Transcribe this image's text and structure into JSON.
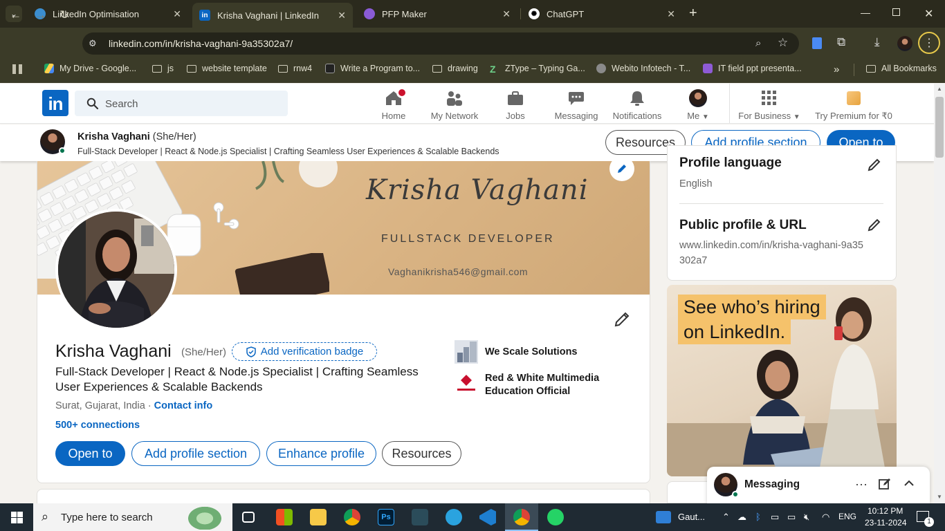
{
  "browser": {
    "tabs": [
      {
        "title": "LinkedIn Optimisation",
        "active": false
      },
      {
        "title": "Krisha Vaghani | LinkedIn",
        "active": true
      },
      {
        "title": "PFP Maker",
        "active": false
      },
      {
        "title": "ChatGPT",
        "active": false
      }
    ],
    "url": "linkedin.com/in/krisha-vaghani-9a35302a7/",
    "bookmarks": [
      "My Drive - Google...",
      "js",
      "website template",
      "rnw4",
      "Write a Program to...",
      "drawing",
      "ZType – Typing Ga...",
      "Webito Infotech - T...",
      "IT field ppt presenta..."
    ],
    "all_bookmarks": "All Bookmarks"
  },
  "linkedin": {
    "search_placeholder": "Search",
    "nav": [
      {
        "label": "Home",
        "icon": "home-icon"
      },
      {
        "label": "My Network",
        "icon": "network-icon"
      },
      {
        "label": "Jobs",
        "icon": "briefcase-icon"
      },
      {
        "label": "Messaging",
        "icon": "message-icon"
      },
      {
        "label": "Notifications",
        "icon": "bell-icon"
      },
      {
        "label": "Me",
        "icon": "avatar"
      },
      {
        "label": "For Business",
        "icon": "grid-icon"
      },
      {
        "label": "Try Premium for ₹0",
        "icon": "premium-icon"
      }
    ],
    "colors": {
      "brand": "#0a66c2",
      "online": "#01754f"
    }
  },
  "sticky": {
    "name": "Krisha Vaghani",
    "pronoun": "(She/Her)",
    "headline": "Full-Stack Developer | React & Node.js Specialist | Crafting Seamless User Experiences & Scalable Backends",
    "buttons": {
      "resources": "Resources",
      "add_section": "Add profile section",
      "open_to": "Open to"
    }
  },
  "banner": {
    "name": "Krisha Vaghani",
    "role": "FULLSTACK DEVELOPER",
    "email": "Vaghanikrisha546@gmail.com"
  },
  "profile": {
    "name": "Krisha Vaghani",
    "pronoun": "(She/Her)",
    "verify": "Add verification badge",
    "headline": "Full-Stack Developer | React & Node.js Specialist | Crafting Seamless User Experiences & Scalable Backends",
    "location": "Surat, Gujarat, India",
    "separator": " · ",
    "contact": "Contact info",
    "connections": "500+ connections",
    "buttons": {
      "open_to": "Open to",
      "add_section": "Add profile section",
      "enhance": "Enhance profile",
      "resources": "Resources"
    },
    "orgs": [
      "We Scale Solutions",
      "Red & White Multimedia Education Official"
    ]
  },
  "right": {
    "profile_language_title": "Profile language",
    "profile_language_value": "English",
    "public_title": "Public profile & URL",
    "public_url": "www.linkedin.com/in/krisha-vaghani-9a35302a7"
  },
  "ad": {
    "line1": "See who’s hiring",
    "line2": "on LinkedIn."
  },
  "messaging": {
    "label": "Messaging"
  },
  "taskbar": {
    "search": "Type here to search",
    "weather": "Gaut...",
    "lang": "ENG",
    "time": "10:12 PM",
    "date": "23-11-2024",
    "notif_count": "1"
  }
}
